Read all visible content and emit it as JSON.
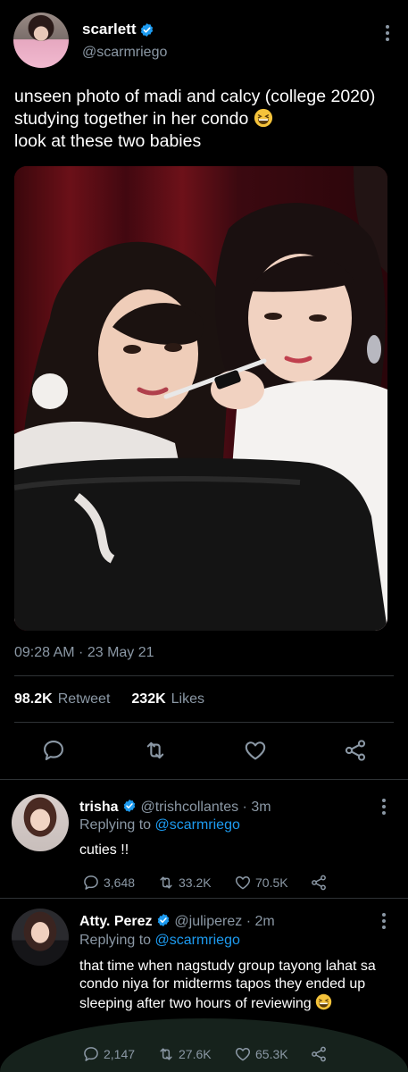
{
  "tweet": {
    "author_name": "scarlett",
    "author_handle": "@scarmriego",
    "text_part1": "unseen photo of madi and calcy (college 2020) studying together in her condo",
    "text_part2": "look at these two babies",
    "emoji": "grinning-squinting-face",
    "timestamp": "09:28 AM · 23 May 21",
    "retweet_count": "98.2K",
    "retweet_label": "Retweet",
    "like_count": "232K",
    "like_label": "Likes"
  },
  "replies": [
    {
      "name": "trisha",
      "handle_time": "@trishcollantes · 3m",
      "replying_prefix": "Replying to",
      "replying_to": "@scarmriego",
      "text": "cuties !!",
      "reply_count": "3,648",
      "retweet_count": "33.2K",
      "like_count": "70.5K"
    },
    {
      "name": "Atty. Perez",
      "handle_time": "@juliperez · 2m",
      "replying_prefix": "Replying to",
      "replying_to": "@scarmriego",
      "text": "that time when nagstudy group tayong lahat sa condo niya for midterms tapos they ended up sleeping after two hours of reviewing",
      "reply_count": "2,147",
      "retweet_count": "27.6K",
      "like_count": "65.3K"
    }
  ],
  "colors": {
    "background": "#000000",
    "text": "#e7e9ea",
    "secondary": "#8b98a5",
    "link": "#1d9bf0",
    "verified": "#1d9bf0"
  },
  "icons": [
    "verified-badge-icon",
    "more-options-icon",
    "reply-icon",
    "retweet-icon",
    "like-icon",
    "share-icon"
  ]
}
